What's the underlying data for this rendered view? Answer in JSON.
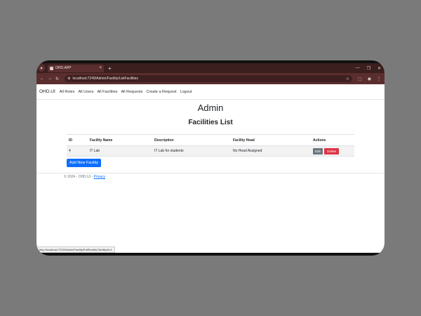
{
  "browser": {
    "tab_title": "OHD.APP",
    "tab_close": "×",
    "new_tab": "+",
    "url": "localhost:7249/Admin/Facility/ListFacilities",
    "status_url": "http://localhost:7249/Admin/Facility/EditFacility?facilityId=4"
  },
  "navbar": {
    "brand": "OHD.UI",
    "links": [
      "All Roles",
      "All Users",
      "All Facilities",
      "All Requests",
      "Create a Request",
      "Logout"
    ]
  },
  "page": {
    "title": "Admin",
    "subtitle": "Facilities List"
  },
  "table": {
    "headers": [
      "ID",
      "Facility Name",
      "Description",
      "Facility Head",
      "Actions"
    ],
    "rows": [
      {
        "id": "4",
        "name": "IT Lab",
        "description": "IT Lab for students",
        "head": "No Head Assigned",
        "edit_label": "Edit",
        "delete_label": "Delete"
      }
    ]
  },
  "add_button_label": "Add New Facility",
  "footer": {
    "copyright": "© 2024 - OHD.UI - ",
    "privacy_label": "Privacy"
  }
}
